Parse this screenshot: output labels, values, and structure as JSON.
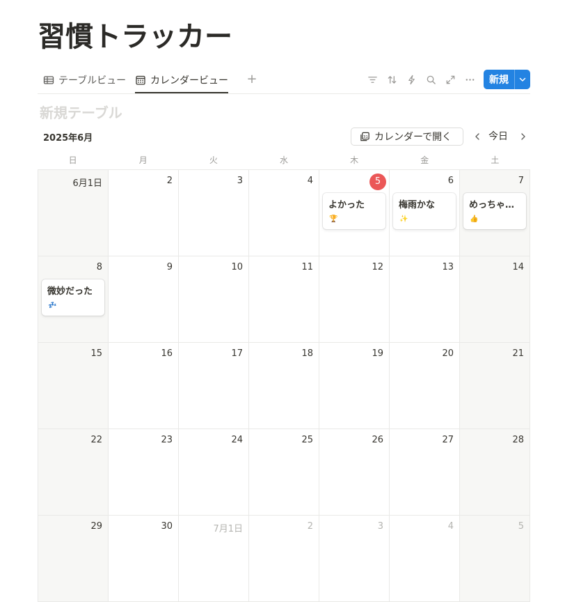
{
  "page": {
    "title": "習慣トラッカー"
  },
  "tabs": [
    {
      "label": "テーブルビュー",
      "icon": "table-icon"
    },
    {
      "label": "カレンダービュー",
      "icon": "calendar-icon"
    }
  ],
  "toolbar": {
    "new_label": "新規"
  },
  "database": {
    "title": "新規テーブル"
  },
  "calendar": {
    "month_label": "2025年6月",
    "open_label": "カレンダーで開く",
    "today_label": "今日",
    "weekdays": [
      "日",
      "月",
      "火",
      "水",
      "木",
      "金",
      "土"
    ],
    "days": [
      "6月1日",
      "2",
      "3",
      "4",
      "5",
      "6",
      "7",
      "8",
      "9",
      "10",
      "11",
      "12",
      "13",
      "14",
      "15",
      "16",
      "17",
      "18",
      "19",
      "20",
      "21",
      "22",
      "23",
      "24",
      "25",
      "26",
      "27",
      "28",
      "29",
      "30",
      "7月1日",
      "2",
      "3",
      "4",
      "5"
    ],
    "today_index": 4,
    "other_month_from": 30,
    "events": [
      {
        "day_index": 4,
        "title": "よかった",
        "icon": "🏆"
      },
      {
        "day_index": 5,
        "title": "梅雨かな",
        "icon": "✨"
      },
      {
        "day_index": 6,
        "title": "めっちゃ良かった",
        "icon": "👍"
      },
      {
        "day_index": 7,
        "title": "微妙だった",
        "icon": "💤"
      }
    ]
  }
}
